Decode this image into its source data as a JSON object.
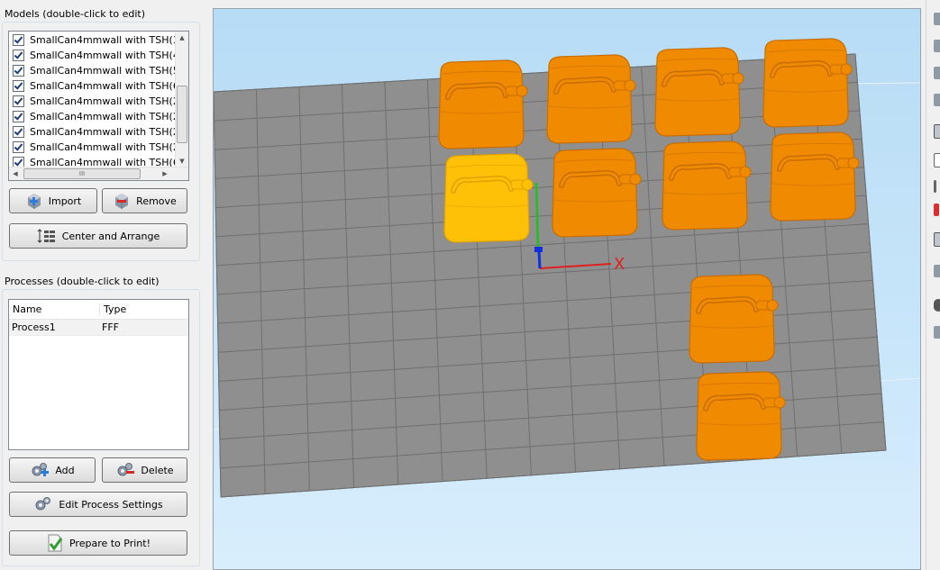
{
  "models_panel": {
    "title": "Models (double-click to edit)",
    "items": [
      {
        "label": "SmallCan4mmwall with TSH(3",
        "checked": true
      },
      {
        "label": "SmallCan4mmwall with TSH(4",
        "checked": true
      },
      {
        "label": "SmallCan4mmwall with TSH(5",
        "checked": true
      },
      {
        "label": "SmallCan4mmwall with TSH(6",
        "checked": true
      },
      {
        "label": "SmallCan4mmwall with TSH(2",
        "checked": true
      },
      {
        "label": "SmallCan4mmwall with TSH(2",
        "checked": true
      },
      {
        "label": "SmallCan4mmwall with TSH(2",
        "checked": true
      },
      {
        "label": "SmallCan4mmwall with TSH(2",
        "checked": true
      },
      {
        "label": "SmallCan4mmwall with TSH(6",
        "checked": true
      }
    ],
    "hscroll_grip": "III",
    "import_label": "Import",
    "remove_label": "Remove",
    "center_arrange_label": "Center and Arrange"
  },
  "processes_panel": {
    "title": "Processes (double-click to edit)",
    "columns": [
      "Name",
      "Type"
    ],
    "rows": [
      {
        "name": "Process1",
        "type": "FFF"
      }
    ],
    "add_label": "Add",
    "delete_label": "Delete",
    "edit_label": "Edit Process Settings",
    "prepare_label": "Prepare to Print!"
  },
  "viewport": {
    "axis_x_label": "X",
    "colors": {
      "model": "#f08a00",
      "model_selected": "#ffc107",
      "bed": "#8f8f8f",
      "sky": "#c6e3f8",
      "x_axis": "#e02020",
      "y_axis": "#20c020",
      "z_axis": "#1030e0"
    }
  }
}
